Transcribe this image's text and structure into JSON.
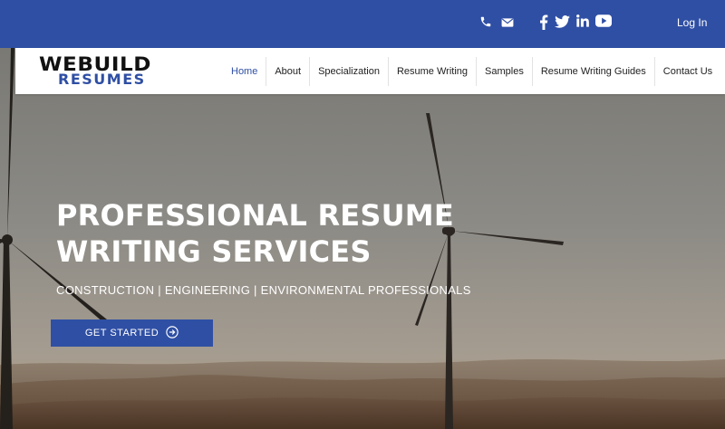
{
  "colors": {
    "brand_blue": "#2f4fa4",
    "hero_text": "#ffffff"
  },
  "topbar": {
    "icons": [
      "phone-icon",
      "email-icon",
      "facebook-icon",
      "twitter-icon",
      "linkedin-icon",
      "youtube-icon"
    ],
    "login_label": "Log In"
  },
  "logo": {
    "line1": "WEBUILD",
    "line2": "RESUMES"
  },
  "nav": {
    "items": [
      {
        "label": "Home",
        "active": true
      },
      {
        "label": "About"
      },
      {
        "label": "Specialization"
      },
      {
        "label": "Resume Writing"
      },
      {
        "label": "Samples"
      },
      {
        "label": "Resume Writing Guides"
      },
      {
        "label": "Contact Us"
      }
    ]
  },
  "hero": {
    "headline_line1": "PROFESSIONAL RESUME",
    "headline_line2": "WRITING SERVICES",
    "subheadline": "CONSTRUCTION | ENGINEERING | ENVIRONMENTAL PROFESSIONALS",
    "cta_label": "GET STARTED"
  }
}
